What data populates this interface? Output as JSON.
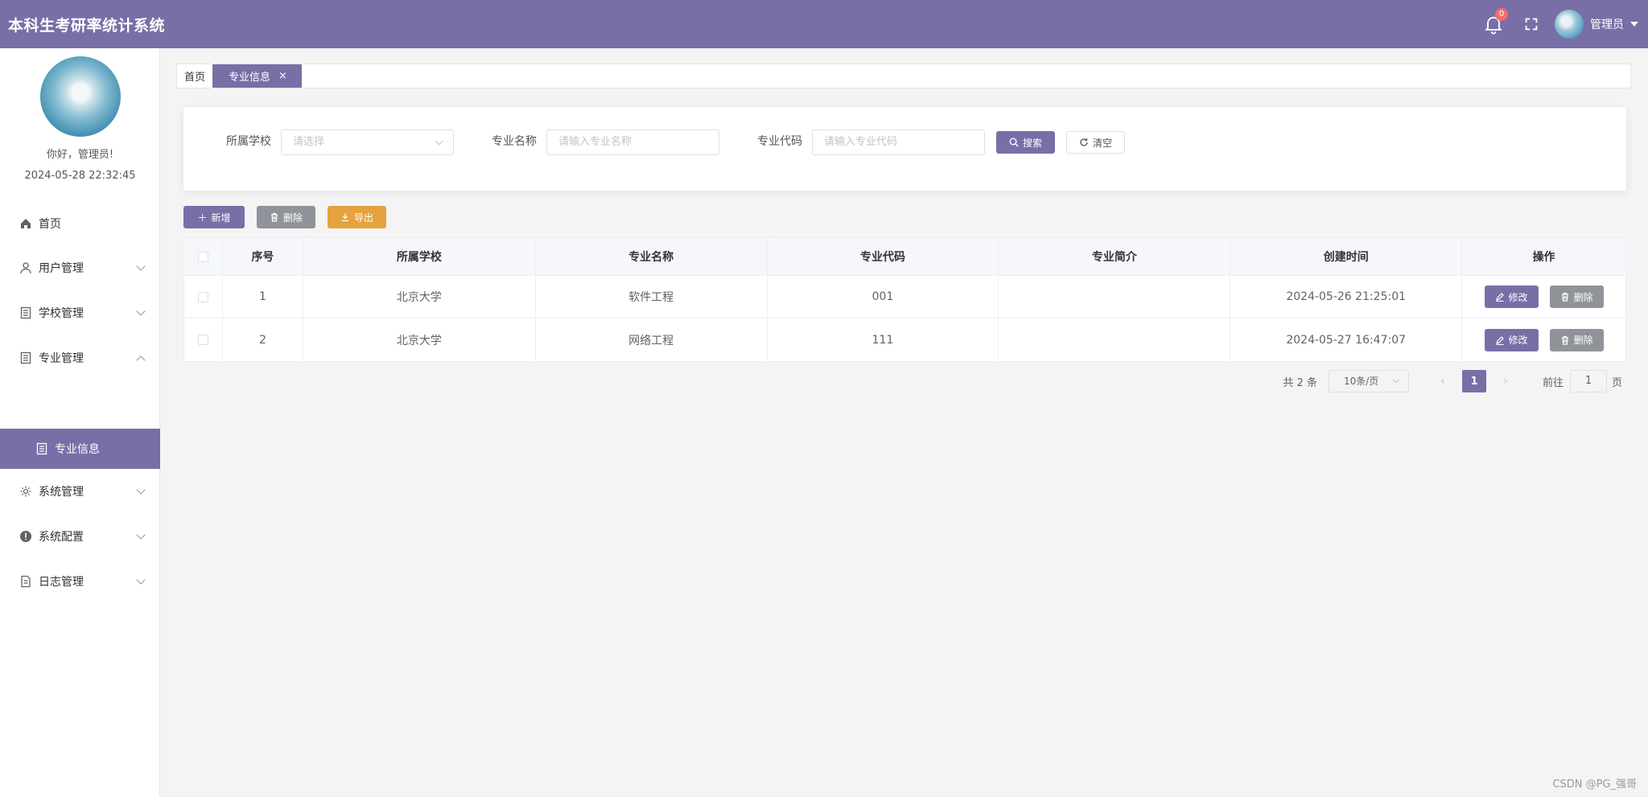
{
  "header": {
    "title": "本科生考研率统计系统",
    "notification_count": "0",
    "user_name": "管理员"
  },
  "sidebar": {
    "greeting": "你好，管理员!",
    "datetime": "2024-05-28 22:32:45",
    "items": [
      {
        "label": "首页",
        "icon": "home-icon"
      },
      {
        "label": "用户管理",
        "icon": "user-icon"
      },
      {
        "label": "学校管理",
        "icon": "document-icon"
      },
      {
        "label": "专业管理",
        "icon": "document-icon"
      },
      {
        "label": "专业信息",
        "icon": "document-icon"
      },
      {
        "label": "系统管理",
        "icon": "gear-icon"
      },
      {
        "label": "系统配置",
        "icon": "info-icon"
      },
      {
        "label": "日志管理",
        "icon": "file-icon"
      }
    ]
  },
  "tabs": {
    "home": "首页",
    "active": "专业信息",
    "close": "×"
  },
  "search": {
    "school_label": "所属学校",
    "school_placeholder": "请选择",
    "major_name_label": "专业名称",
    "major_name_placeholder": "请输入专业名称",
    "major_code_label": "专业代码",
    "major_code_placeholder": "请输入专业代码",
    "search_button": "搜索",
    "clear_button": "清空"
  },
  "toolbar": {
    "add": "新增",
    "delete": "删除",
    "export": "导出"
  },
  "table": {
    "columns": [
      "序号",
      "所属学校",
      "专业名称",
      "专业代码",
      "专业简介",
      "创建时间",
      "操作"
    ],
    "rows": [
      {
        "index": "1",
        "school": "北京大学",
        "name": "软件工程",
        "code": "001",
        "intro": "",
        "created": "2024-05-26 21:25:01"
      },
      {
        "index": "2",
        "school": "北京大学",
        "name": "网络工程",
        "code": "111",
        "intro": "",
        "created": "2024-05-27 16:47:07"
      }
    ],
    "edit_label": "修改",
    "delete_label": "删除"
  },
  "pagination": {
    "total": "共 2 条",
    "page_size": "10条/页",
    "current_page": "1",
    "goto_prefix": "前往",
    "goto_value": "1",
    "goto_suffix": "页"
  },
  "watermark": "CSDN @PG_强哥",
  "colors": {
    "primary": "#776fa6",
    "gray_button": "#909399",
    "orange_button": "#e6a23c",
    "badge": "#f56c6c"
  }
}
